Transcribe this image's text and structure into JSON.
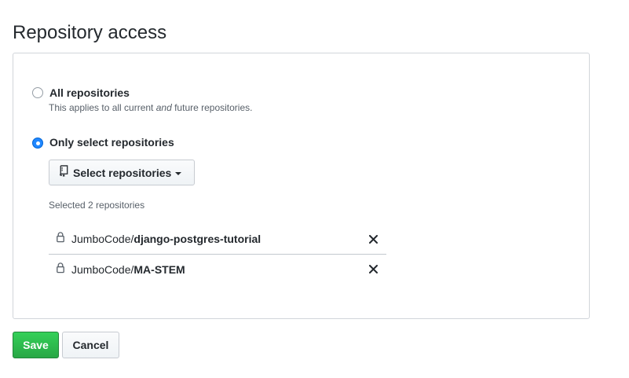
{
  "page": {
    "title": "Repository access"
  },
  "options": {
    "all": {
      "label": "All repositories",
      "note_before": "This applies to all current ",
      "note_em": "and",
      "note_after": " future repositories."
    },
    "select": {
      "label": "Only select repositories"
    }
  },
  "select_button": {
    "label": "Select repositories",
    "icon": "repo-icon"
  },
  "selected_count": "Selected 2 repositories",
  "repos": [
    {
      "owner": "JumboCode/",
      "name": "django-postgres-tutorial",
      "icon": "lock-icon"
    },
    {
      "owner": "JumboCode/",
      "name": "MA-STEM",
      "icon": "lock-icon"
    }
  ],
  "actions": {
    "save": "Save",
    "cancel": "Cancel"
  },
  "colors": {
    "primary": "#28a745",
    "radio_selected": "#2188ff"
  }
}
